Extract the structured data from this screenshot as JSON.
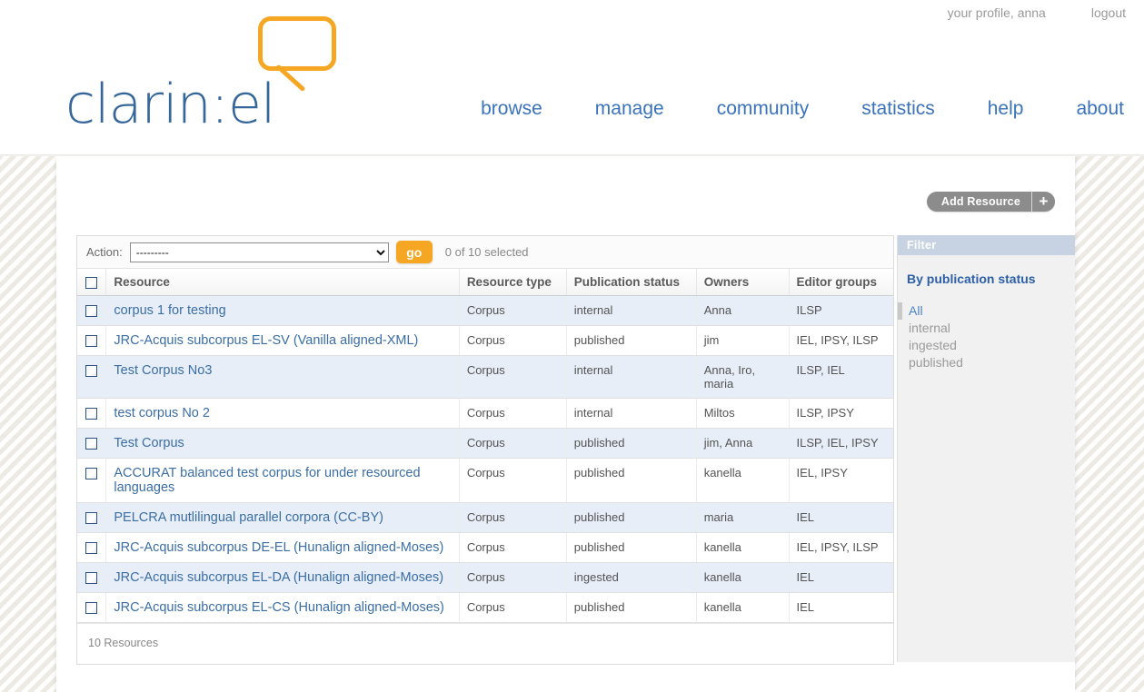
{
  "header": {
    "user_links": [
      {
        "label": "your profile, anna",
        "name": "profile-link"
      },
      {
        "label": "logout",
        "name": "logout-link"
      }
    ],
    "logo_text": "clarin:el",
    "nav": [
      {
        "label": "browse"
      },
      {
        "label": "manage"
      },
      {
        "label": "community"
      },
      {
        "label": "statistics"
      },
      {
        "label": "help"
      },
      {
        "label": "about"
      }
    ]
  },
  "add_resource": {
    "label": "Add Resource",
    "plus": "+"
  },
  "toolbar": {
    "action_label": "Action:",
    "action_value": "---------",
    "action_options": [
      "---------"
    ],
    "go_label": "go",
    "selected_text": "0 of 10 selected"
  },
  "table": {
    "columns": [
      "Resource",
      "Resource type",
      "Publication status",
      "Owners",
      "Editor groups"
    ],
    "rows": [
      {
        "resource": "corpus 1 for testing",
        "type": "Corpus",
        "status": "internal",
        "owners": "Anna",
        "editor_groups": "ILSP"
      },
      {
        "resource": "JRC-Acquis subcorpus EL-SV (Vanilla aligned-XML)",
        "type": "Corpus",
        "status": "published",
        "owners": "jim",
        "editor_groups": "IEL, IPSY, ILSP"
      },
      {
        "resource": "Test Corpus No3",
        "type": "Corpus",
        "status": "internal",
        "owners": "Anna, Iro, maria",
        "editor_groups": "ILSP, IEL"
      },
      {
        "resource": "test corpus No 2",
        "type": "Corpus",
        "status": "internal",
        "owners": "Miltos",
        "editor_groups": "ILSP, IPSY"
      },
      {
        "resource": "Test Corpus",
        "type": "Corpus",
        "status": "published",
        "owners": "jim, Anna",
        "editor_groups": "ILSP, IEL, IPSY"
      },
      {
        "resource": "ACCURAT balanced test corpus for under resourced languages",
        "type": "Corpus",
        "status": "published",
        "owners": "kanella",
        "editor_groups": "IEL, IPSY"
      },
      {
        "resource": "PELCRA mutlilingual parallel corpora (CC-BY)",
        "type": "Corpus",
        "status": "published",
        "owners": "maria",
        "editor_groups": "IEL"
      },
      {
        "resource": "JRC-Acquis subcorpus DE-EL (Hunalign aligned-Moses)",
        "type": "Corpus",
        "status": "published",
        "owners": "kanella",
        "editor_groups": "IEL, IPSY, ILSP"
      },
      {
        "resource": "JRC-Acquis subcorpus EL-DA (Hunalign aligned-Moses)",
        "type": "Corpus",
        "status": "ingested",
        "owners": "kanella",
        "editor_groups": "IEL"
      },
      {
        "resource": "JRC-Acquis subcorpus EL-CS (Hunalign aligned-Moses)",
        "type": "Corpus",
        "status": "published",
        "owners": "kanella",
        "editor_groups": "IEL"
      }
    ],
    "paginator": "10 Resources"
  },
  "filter": {
    "title": "Filter",
    "group_title": "By publication status",
    "options": [
      {
        "label": "All",
        "selected": true
      },
      {
        "label": "internal",
        "selected": false
      },
      {
        "label": "ingested",
        "selected": false
      },
      {
        "label": "published",
        "selected": false
      }
    ]
  },
  "colors": {
    "brand_blue": "#35679b",
    "brand_orange": "#f5a623",
    "nav_link": "#3a73bb",
    "row_alt": "#e8eef7",
    "filter_header": "#c7d3e3"
  }
}
